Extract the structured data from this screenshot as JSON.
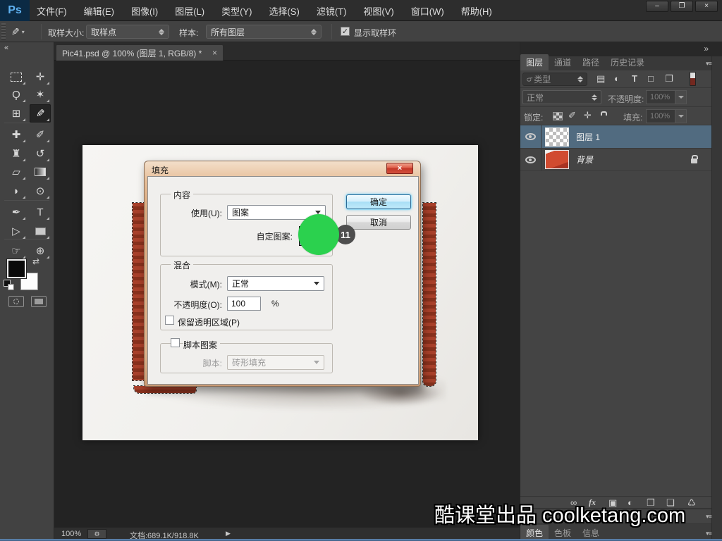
{
  "colors": {
    "accent_green": "#2bd14e",
    "badge_gray": "#4e4e4e",
    "selected_layer": "#516b80",
    "ps_blue": "#5fb2f2"
  },
  "menubar": {
    "logo": "Ps",
    "items": [
      "文件(F)",
      "编辑(E)",
      "图像(I)",
      "图层(L)",
      "类型(Y)",
      "选择(S)",
      "滤镜(T)",
      "视图(V)",
      "窗口(W)",
      "帮助(H)"
    ],
    "window_controls": {
      "minimize": "–",
      "restore": "❐",
      "close": "×"
    }
  },
  "options_bar": {
    "tool_icon": "✎",
    "tool_arrow": "▾",
    "sample_size_label": "取样大小:",
    "sample_size_value": "取样点",
    "sample_label": "样本:",
    "sample_value": "所有图层",
    "check_glyph": "✓",
    "show_ring_label": "显示取样环"
  },
  "toolbar": {
    "collapse_icon": "«",
    "tools": [
      {
        "name": "rectangular-marquee",
        "glyph": ""
      },
      {
        "name": "move",
        "glyph": "✛"
      },
      {
        "name": "lasso",
        "glyph": "Ϙ"
      },
      {
        "name": "magic-wand",
        "glyph": "✶"
      },
      {
        "name": "crop",
        "glyph": "⊞"
      },
      {
        "name": "eyedropper",
        "glyph": "✎"
      },
      {
        "name": "healing-brush",
        "glyph": "✚"
      },
      {
        "name": "brush",
        "glyph": "✐"
      },
      {
        "name": "clone-stamp",
        "glyph": "♜"
      },
      {
        "name": "history-brush",
        "glyph": "↺"
      },
      {
        "name": "eraser",
        "glyph": "▱"
      },
      {
        "name": "gradient",
        "glyph": ""
      },
      {
        "name": "blur",
        "glyph": "◗"
      },
      {
        "name": "dodge",
        "glyph": "⊙"
      },
      {
        "name": "pen",
        "glyph": "✒"
      },
      {
        "name": "type",
        "glyph": "T"
      },
      {
        "name": "path-selection",
        "glyph": "▷"
      },
      {
        "name": "shape",
        "glyph": ""
      },
      {
        "name": "hand",
        "glyph": "☞"
      },
      {
        "name": "zoom",
        "glyph": "⊕"
      }
    ],
    "swap_icon": "⇄"
  },
  "document_tab": {
    "title": "Pic41.psd @ 100% (图层 1, RGB/8) *",
    "close": "×"
  },
  "fill_dialog": {
    "title": "填充",
    "close": "×",
    "content_group": {
      "label": "内容",
      "use_label": "使用(U):",
      "use_value": "图案",
      "pattern_label": "自定图案:",
      "pattern_arrow": "▾"
    },
    "ok": "确定",
    "cancel": "取消",
    "blend_group": {
      "label": "混合",
      "mode_label": "模式(M):",
      "mode_value": "正常",
      "opacity_label": "不透明度(O):",
      "opacity_value": "100",
      "percent": "%",
      "preserve_label": "保留透明区域(P)"
    },
    "script_group": {
      "label": "脚本图案",
      "script_label": "脚本:",
      "script_value": "砖形填充"
    },
    "annotation_step": "11"
  },
  "layers_panel": {
    "tabs": [
      {
        "label": "图层"
      },
      {
        "label": "通道"
      },
      {
        "label": "路径"
      },
      {
        "label": "历史记录"
      }
    ],
    "filter": {
      "search_icon": "ρ",
      "kind_label": "类型",
      "icons": [
        {
          "name": "filter-pixel-layers",
          "glyph": "▤"
        },
        {
          "name": "filter-adjustment-layers",
          "glyph": "◐"
        },
        {
          "name": "filter-type-layers",
          "glyph": "T"
        },
        {
          "name": "filter-shape-layers",
          "glyph": "□"
        },
        {
          "name": "filter-smart-objects",
          "glyph": "❐"
        }
      ]
    },
    "blend_mode_value": "正常",
    "opacity_label": "不透明度:",
    "opacity_value": "100%",
    "lock_label": "锁定:",
    "lock_brush_glyph": "✐",
    "lock_move_glyph": "✛",
    "fill_label": "填充:",
    "fill_value": "100%",
    "layers": [
      {
        "name": "图层 1"
      },
      {
        "name": "背景"
      }
    ],
    "bottom_icons": [
      {
        "name": "link-layers",
        "glyph": "∞"
      },
      {
        "name": "layer-style",
        "glyph": "fx"
      },
      {
        "name": "layer-mask",
        "glyph": "▣"
      },
      {
        "name": "adjustment-layer",
        "glyph": "◐"
      },
      {
        "name": "layer-group",
        "glyph": "❒"
      },
      {
        "name": "new-layer",
        "glyph": "❏"
      },
      {
        "name": "delete-layer",
        "glyph": "♺"
      }
    ]
  },
  "color_panel_tabs": {
    "tabs": [
      "颜色",
      "色板",
      "信息"
    ]
  },
  "status_bar": {
    "zoom": "100%",
    "gear": "⚙",
    "doc_info": "文档:689.1K/918.8K",
    "arrow": "▶"
  },
  "dock_icons": {
    "expand": "»",
    "panel_menu": "▾≡"
  },
  "watermark": "酷课堂出品 coolketang.com"
}
